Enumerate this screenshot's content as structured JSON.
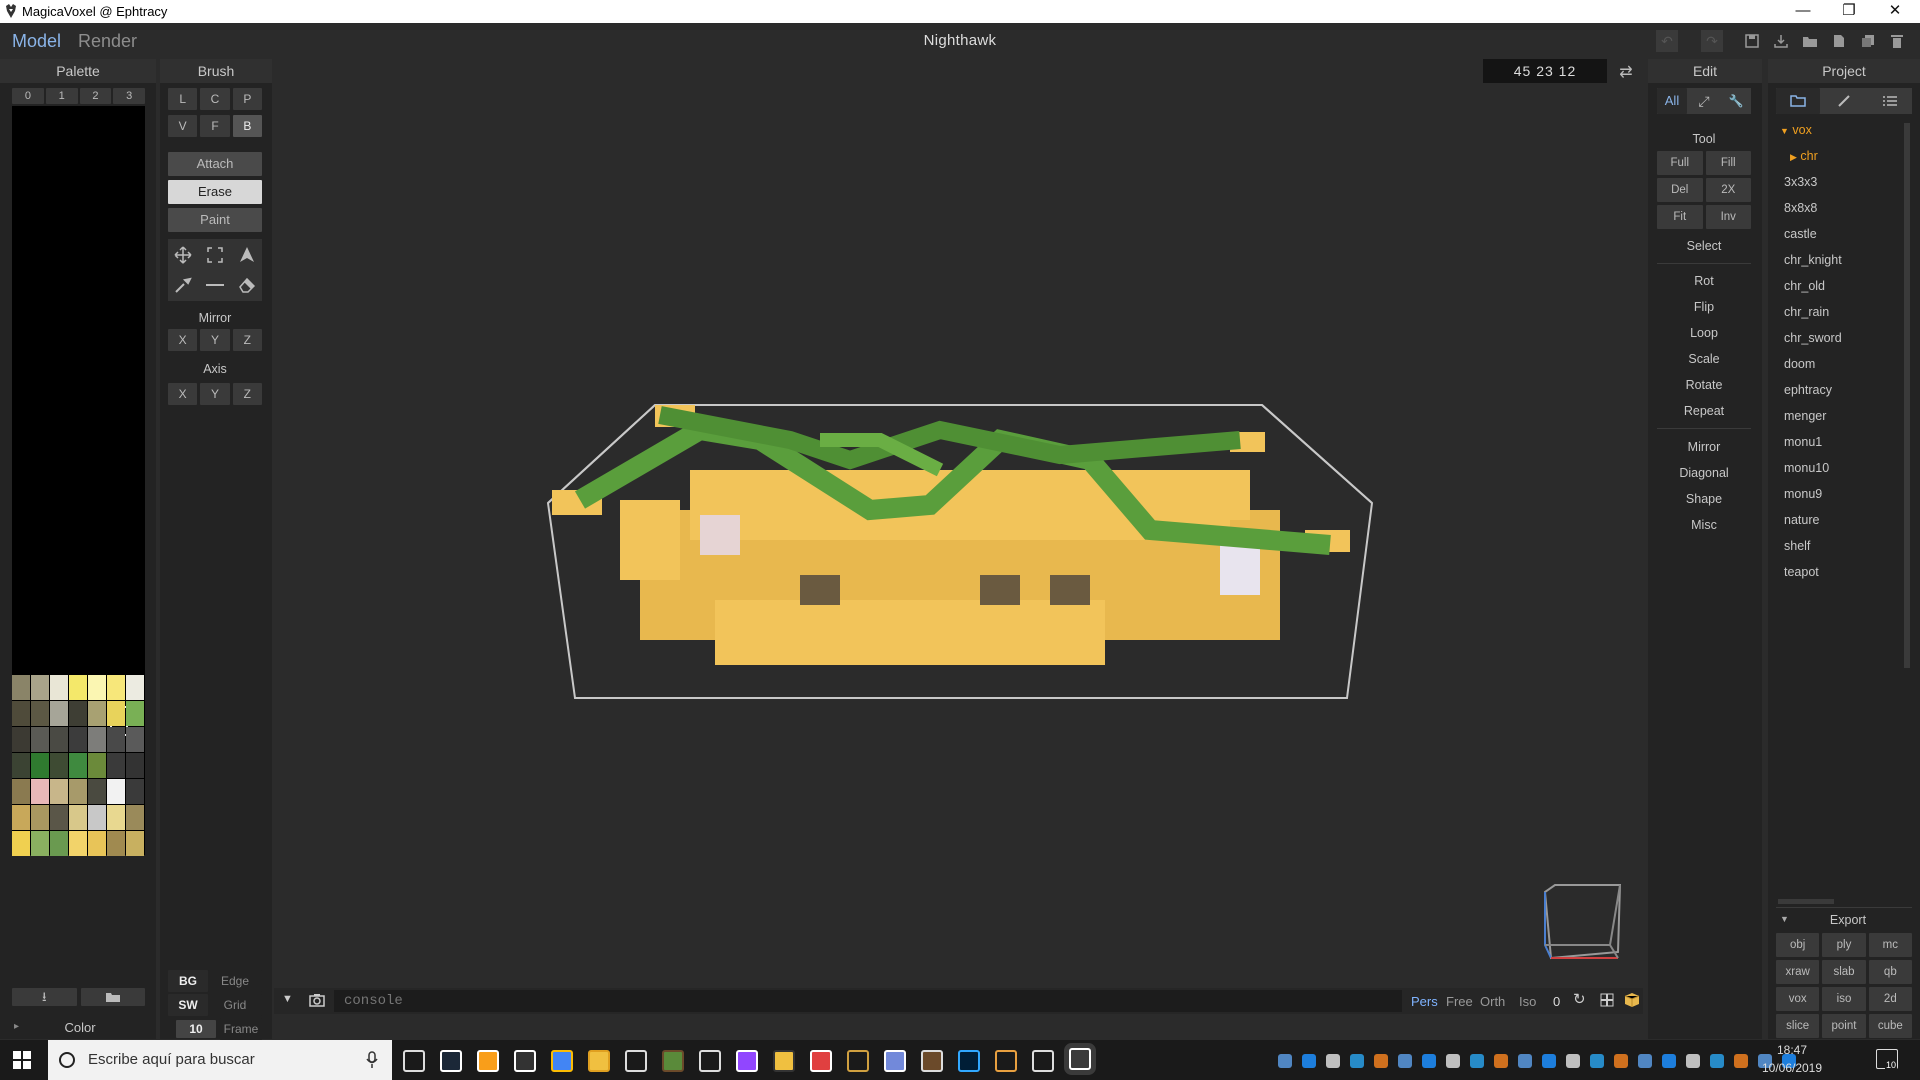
{
  "window": {
    "title": "MagicaVoxel @ Ephtracy",
    "minimize": "—",
    "restore": "❐",
    "close": "✕"
  },
  "menu": {
    "tabs": [
      {
        "label": "Model",
        "active": true
      },
      {
        "label": "Render",
        "active": false
      }
    ],
    "document_title": "Nighthawk"
  },
  "toolbar_icons": [
    "undo-icon",
    "redo-icon",
    "save-icon",
    "save-as-icon",
    "open-icon",
    "new-icon",
    "duplicate-icon",
    "delete-icon"
  ],
  "palette": {
    "header": "Palette",
    "pages": [
      "0",
      "1",
      "2",
      "3"
    ],
    "footer_label": "Color",
    "swatches": [
      [
        "#8a8468",
        "#a9a48a",
        "#e9e6d6",
        "#f4e86a",
        "#fbf6b2",
        "#f7e77a",
        "#ecebe1"
      ],
      [
        "#4f4b3a",
        "#5c5844",
        "#a6a598",
        "#3e3e34",
        "#a8a172",
        "#e8d35b",
        "#79b055"
      ],
      [
        "#3c3a33",
        "#5a5a55",
        "#4a4a44",
        "#3c3c3c",
        "#7d7d7a",
        "#494949",
        "#5a5a5a"
      ],
      [
        "#3b4333",
        "#2f7a2f",
        "#3e4b33",
        "#3f8a3f",
        "#6b8a3a",
        "#3a3a3a",
        "#333333"
      ],
      [
        "#8a7a50",
        "#e8b8b8",
        "#c8b68a",
        "#a79a6a",
        "#4a4a40",
        "#f2f2f2",
        "#3a3a3a"
      ],
      [
        "#c8a85a",
        "#a89860",
        "#5a5648",
        "#d8c88a",
        "#c8c8c8",
        "#e8d890",
        "#9a8a5a"
      ],
      [
        "#f0d050",
        "#8ab060",
        "#6a9a50",
        "#f2d36a",
        "#e8c458",
        "#a08a50",
        "#c8b060"
      ]
    ]
  },
  "brush": {
    "header": "Brush",
    "row1": [
      {
        "label": "L",
        "sel": false
      },
      {
        "label": "C",
        "sel": false
      },
      {
        "label": "P",
        "sel": false
      }
    ],
    "row2": [
      {
        "label": "V",
        "sel": false
      },
      {
        "label": "F",
        "sel": false
      },
      {
        "label": "B",
        "sel": true
      }
    ],
    "modes": [
      {
        "label": "Attach",
        "style": "normal"
      },
      {
        "label": "Erase",
        "style": "light"
      },
      {
        "label": "Paint",
        "style": "normal"
      }
    ],
    "tool_icons": [
      "move-icon",
      "select-box-icon",
      "pen-icon",
      "eyedropper-icon",
      "line-icon",
      "eraser-icon"
    ],
    "mirror_label": "Mirror",
    "mirror": [
      "X",
      "Y",
      "Z"
    ],
    "axis_label": "Axis",
    "axis": [
      "X",
      "Y",
      "Z"
    ],
    "bottom": [
      {
        "left": "BG",
        "right": "Edge"
      },
      {
        "left": "SW",
        "right": "Grid"
      },
      {
        "left": "10",
        "right": "Frame"
      }
    ]
  },
  "viewport": {
    "coords": "45  23  12",
    "console_placeholder": "console",
    "view_modes": [
      {
        "label": "Pers",
        "active": true
      },
      {
        "label": "Free",
        "active": false
      },
      {
        "label": "Orth",
        "active": false
      },
      {
        "label": "Iso",
        "active": false
      }
    ],
    "angle": "0"
  },
  "edit": {
    "header": "Edit",
    "top_buttons": [
      {
        "label": "All",
        "sel": true
      },
      {
        "label": "⤢",
        "sel": false
      },
      {
        "label": "🔧",
        "sel": false
      }
    ],
    "tool_label": "Tool",
    "tool_grid": [
      [
        "Full",
        "Fill"
      ],
      [
        "Del",
        "2X"
      ],
      [
        "Fit",
        "Inv"
      ]
    ],
    "select_label": "Select",
    "items1": [
      "Rot",
      "Flip",
      "Loop",
      "Scale",
      "Rotate",
      "Repeat"
    ],
    "items2": [
      "Mirror",
      "Diagonal",
      "Shape",
      "Misc"
    ]
  },
  "project": {
    "header": "Project",
    "folder": "vox",
    "subfolder": "chr",
    "files": [
      "3x3x3",
      "8x8x8",
      "castle",
      "chr_knight",
      "chr_old",
      "chr_rain",
      "chr_sword",
      "doom",
      "ephtracy",
      "menger",
      "monu1",
      "monu10",
      "monu9",
      "nature",
      "shelf",
      "teapot"
    ],
    "export_label": "Export",
    "export_formats": [
      [
        "obj",
        "ply",
        "mc"
      ],
      [
        "xraw",
        "slab",
        "qb"
      ],
      [
        "vox",
        "iso",
        "2d"
      ],
      [
        "slice",
        "point",
        "cube"
      ]
    ]
  },
  "taskbar": {
    "search_placeholder": "Escribe aquí para buscar",
    "time": "18:47",
    "date": "10/06/2019",
    "notifications": "10"
  },
  "colors": {
    "voxel_yellow": "#f2c45a",
    "voxel_green": "#5a9e3c",
    "accent": "#7fb3ff"
  }
}
